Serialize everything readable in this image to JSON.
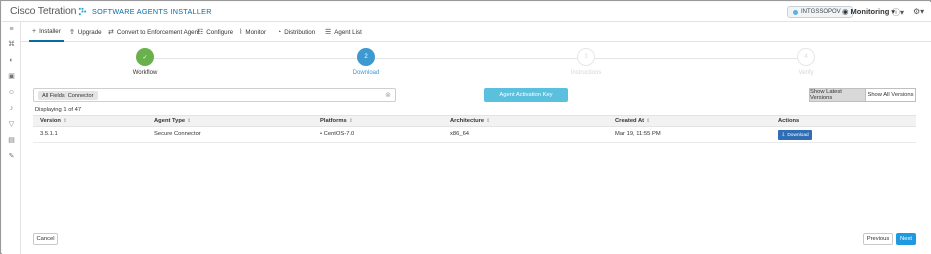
{
  "header": {
    "logo_text": "Cisco Tetration",
    "app_title": "SOFTWARE AGENTS INSTALLER",
    "scope_label": "INTGSSOPOV",
    "monitoring_label": "Monitoring",
    "help_icon": "question-circle-icon",
    "settings_icon": "gear-icon"
  },
  "sidebar": {
    "icons": [
      "dashboard-icon",
      "topology-icon",
      "shield-icon",
      "flow-icon",
      "user-icon",
      "bell-icon",
      "filter-icon",
      "server-icon",
      "wrench-icon"
    ]
  },
  "tabs": [
    {
      "label": "Installer",
      "icon": "plus-icon",
      "active": true
    },
    {
      "label": "Upgrade",
      "icon": "upgrade-icon"
    },
    {
      "label": "Convert to Enforcement Agent",
      "icon": "swap-icon"
    },
    {
      "label": "Configure",
      "icon": "sliders-icon"
    },
    {
      "label": "Monitor",
      "icon": "pulse-icon"
    },
    {
      "label": "Distribution",
      "icon": "pie-icon"
    },
    {
      "label": "Agent List",
      "icon": "list-icon"
    }
  ],
  "wizard": {
    "steps": [
      {
        "label": "Workflow",
        "marker": "✓",
        "state": "done"
      },
      {
        "label": "Download",
        "marker": "2",
        "state": "current"
      },
      {
        "label": "Instructions",
        "marker": "3",
        "state": "future"
      },
      {
        "label": "Verify",
        "marker": "4",
        "state": "future"
      }
    ]
  },
  "filter": {
    "chip_field": "All Fields",
    "chip_value": "Connector"
  },
  "agent_activation_key_label": "Agent Activation Key",
  "version_toggle": {
    "latest_label": "Show Latest Versions",
    "all_label": "Show All Versions",
    "selected": "Show Latest Versions"
  },
  "display_count": "Displaying 1 of 47",
  "table": {
    "columns": [
      "Version",
      "Agent Type",
      "Platforms",
      "Architecture",
      "Created At",
      "Actions"
    ],
    "rows": [
      {
        "version": "3.5.1.1",
        "agent_type": "Secure Connector",
        "platform": "CentOS-7.0",
        "architecture": "x86_64",
        "created_at": "Mar 19, 11:55 PM",
        "action_label": "Download"
      }
    ]
  },
  "footer": {
    "cancel_label": "Cancel",
    "previous_label": "Previous",
    "next_label": "Next"
  },
  "colors": {
    "brand_blue": "#0a6aa1",
    "step_done": "#6ab04c",
    "step_current": "#3d9ad1",
    "activation_button": "#5bc0de",
    "download_button": "#2f6eb5",
    "next_button": "#1e9be0"
  }
}
